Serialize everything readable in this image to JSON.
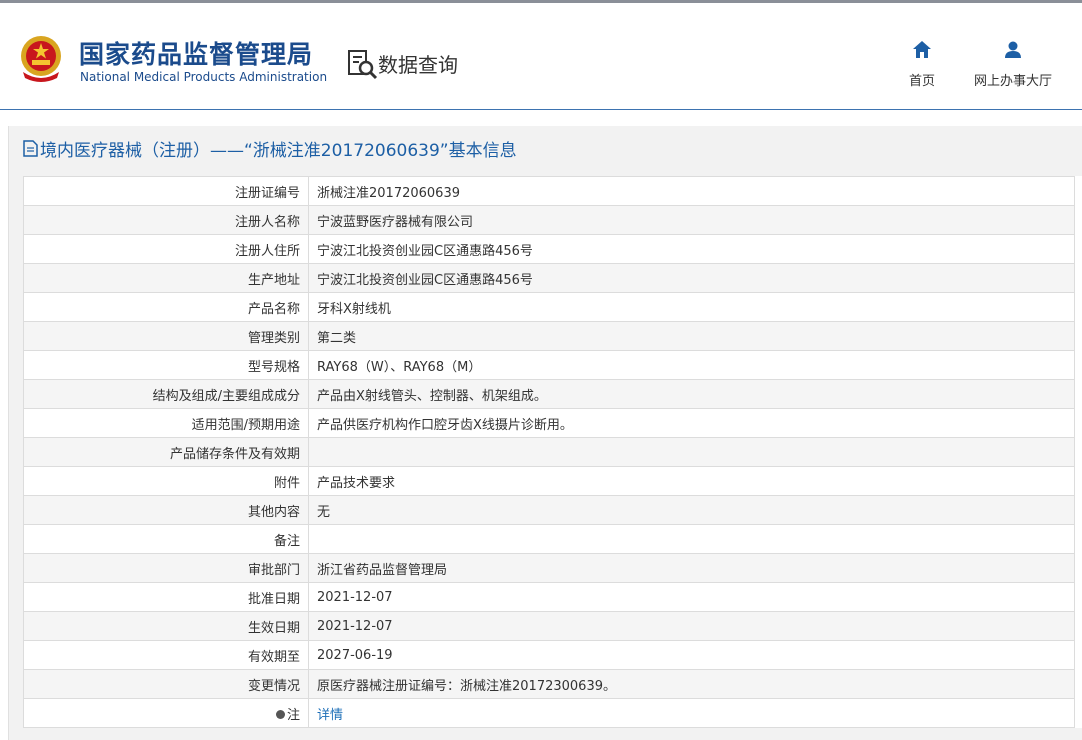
{
  "header": {
    "logo_cn": "国家药品监督管理局",
    "logo_en": "National Medical Products Administration",
    "section": "数据查询",
    "nav": [
      {
        "label": "首页",
        "icon": "home-icon"
      },
      {
        "label": "网上办事大厅",
        "icon": "user-icon"
      }
    ]
  },
  "panel": {
    "title": "境内医疗器械（注册）——“浙械注准20172060639”基本信息"
  },
  "rows": [
    {
      "key": "注册证编号",
      "value": "浙械注准20172060639"
    },
    {
      "key": "注册人名称",
      "value": "宁波蓝野医疗器械有限公司"
    },
    {
      "key": "注册人住所",
      "value": "宁波江北投资创业园C区通惠路456号"
    },
    {
      "key": "生产地址",
      "value": "宁波江北投资创业园C区通惠路456号"
    },
    {
      "key": "产品名称",
      "value": "牙科X射线机"
    },
    {
      "key": "管理类别",
      "value": "第二类"
    },
    {
      "key": "型号规格",
      "value": "RAY68（W）、RAY68（M）"
    },
    {
      "key": "结构及组成/主要组成成分",
      "value": "产品由X射线管头、控制器、机架组成。"
    },
    {
      "key": "适用范围/预期用途",
      "value": "产品供医疗机构作口腔牙齿X线摄片诊断用。"
    },
    {
      "key": "产品储存条件及有效期",
      "value": ""
    },
    {
      "key": "附件",
      "value": "产品技术要求"
    },
    {
      "key": "其他内容",
      "value": "无"
    },
    {
      "key": "备注",
      "value": ""
    },
    {
      "key": "审批部门",
      "value": "浙江省药品监督管理局"
    },
    {
      "key": "批准日期",
      "value": "2021-12-07"
    },
    {
      "key": "生效日期",
      "value": "2021-12-07"
    },
    {
      "key": "有效期至",
      "value": "2027-06-19"
    },
    {
      "key": "变更情况",
      "value": "原医疗器械注册证编号：浙械注准20172300639。"
    }
  ],
  "note": {
    "key": "注",
    "link": "详情"
  },
  "colors": {
    "brand": "#1b4b8c",
    "link": "#1d6fb8",
    "border": "#dcdcdc"
  }
}
